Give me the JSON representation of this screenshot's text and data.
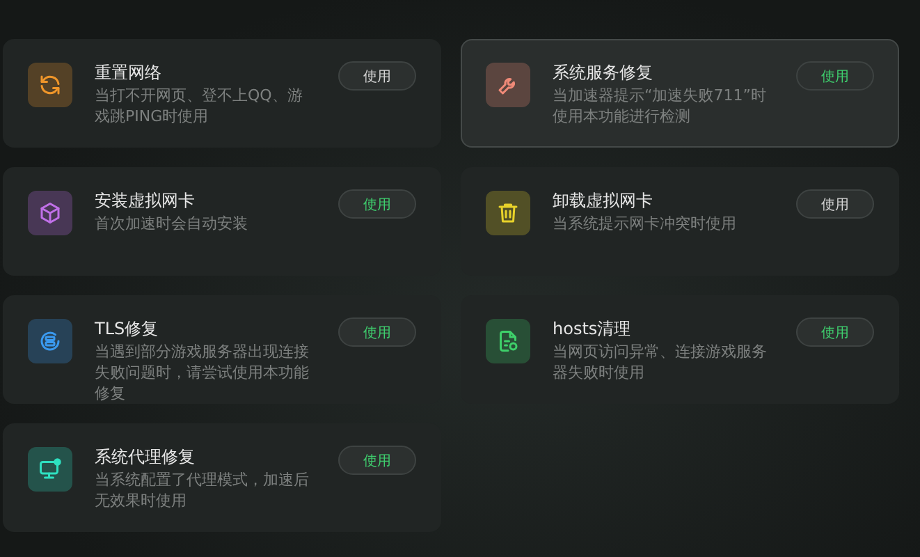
{
  "tools": [
    {
      "title": "重置网络",
      "description": "当打不开网页、登不上QQ、游戏跳PING时使用",
      "kind": "refresh",
      "color": "#f0962a",
      "button": {
        "label": "使用",
        "highlighted": false
      },
      "hovered": false
    },
    {
      "title": "系统服务修复",
      "description": "当加速器提示“加速失败711”时使用本功能进行检测",
      "kind": "wrench",
      "color": "#f08a78",
      "button": {
        "label": "使用",
        "highlighted": true
      },
      "hovered": true
    },
    {
      "title": "安装虚拟网卡",
      "description": "首次加速时会自动安装",
      "kind": "cube",
      "color": "#c070e8",
      "button": {
        "label": "使用",
        "highlighted": true
      },
      "hovered": false
    },
    {
      "title": "卸载虚拟网卡",
      "description": "当系统提示网卡冲突时使用",
      "kind": "trash",
      "color": "#e8d22a",
      "button": {
        "label": "使用",
        "highlighted": false
      },
      "hovered": false
    },
    {
      "title": "TLS修复",
      "description": "当遇到部分游戏服务器出现连接失败问题时，请尝试使用本功能修复",
      "kind": "server",
      "color": "#3a9af0",
      "button": {
        "label": "使用",
        "highlighted": true
      },
      "hovered": false
    },
    {
      "title": "hosts清理",
      "description": "当网页访问异常、连接游戏服务器失败时使用",
      "kind": "document",
      "color": "#3ed06a",
      "button": {
        "label": "使用",
        "highlighted": true
      },
      "hovered": false
    },
    {
      "title": "系统代理修复",
      "description": "当系统配置了代理模式，加速后无效果时使用",
      "kind": "monitor",
      "color": "#2ee0c0",
      "button": {
        "label": "使用",
        "highlighted": true
      },
      "hovered": false
    }
  ]
}
